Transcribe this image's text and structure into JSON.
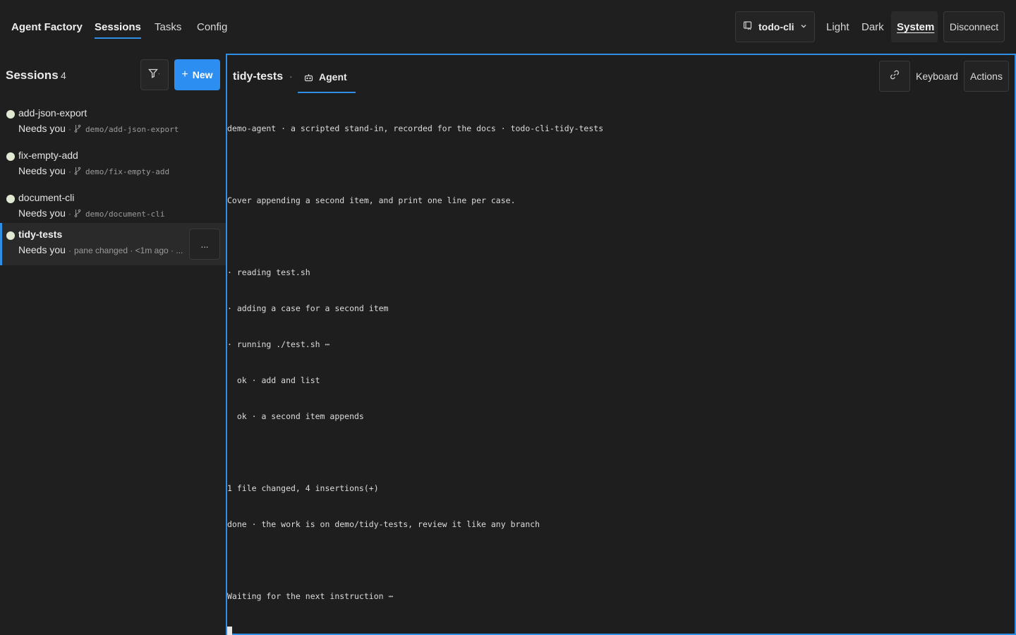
{
  "header": {
    "brand": "Agent Factory",
    "nav": [
      "Sessions",
      "Tasks",
      "Config"
    ],
    "active_nav": "Sessions",
    "repo": "todo-cli",
    "themes": [
      "Light",
      "Dark",
      "System"
    ],
    "active_theme": "System",
    "disconnect": "Disconnect"
  },
  "sidebar": {
    "title": "Sessions",
    "count": "4",
    "new_label": "New",
    "more_label": "...",
    "sessions": [
      {
        "name": "add-json-export",
        "status": "Needs you",
        "sep": "·",
        "branch": "demo/add-json-export"
      },
      {
        "name": "fix-empty-add",
        "status": "Needs you",
        "sep": "·",
        "branch": "demo/fix-empty-add"
      },
      {
        "name": "document-cli",
        "status": "Needs you",
        "sep": "·",
        "branch": "demo/document-cli"
      },
      {
        "name": "tidy-tests",
        "status": "Needs you",
        "sep": "·",
        "meta": "pane changed · <1m ago · ...",
        "selected": true
      }
    ]
  },
  "pane": {
    "title": "tidy-tests",
    "separator": "·",
    "tab_label": "Agent",
    "keyboard_label": "Keyboard",
    "actions_label": "Actions",
    "terminal_lines": [
      "demo-agent · a scripted stand-in, recorded for the docs · todo-cli-tidy-tests",
      "",
      "Cover appending a second item, and print one line per case.",
      "",
      "· reading test.sh",
      "· adding a case for a second item",
      "· running ./test.sh ⋯",
      "  ok · add and list",
      "  ok · a second item appends",
      "",
      "1 file changed, 4 insertions(+)",
      "done · the work is on demo/tidy-tests, review it like any branch",
      "",
      "Waiting for the next instruction ⋯"
    ]
  },
  "colors": {
    "accent": "#2f8ee5",
    "primary_button": "#2b8ef0",
    "background": "#1f1f1f",
    "status_dot": "#dfe8d0"
  }
}
